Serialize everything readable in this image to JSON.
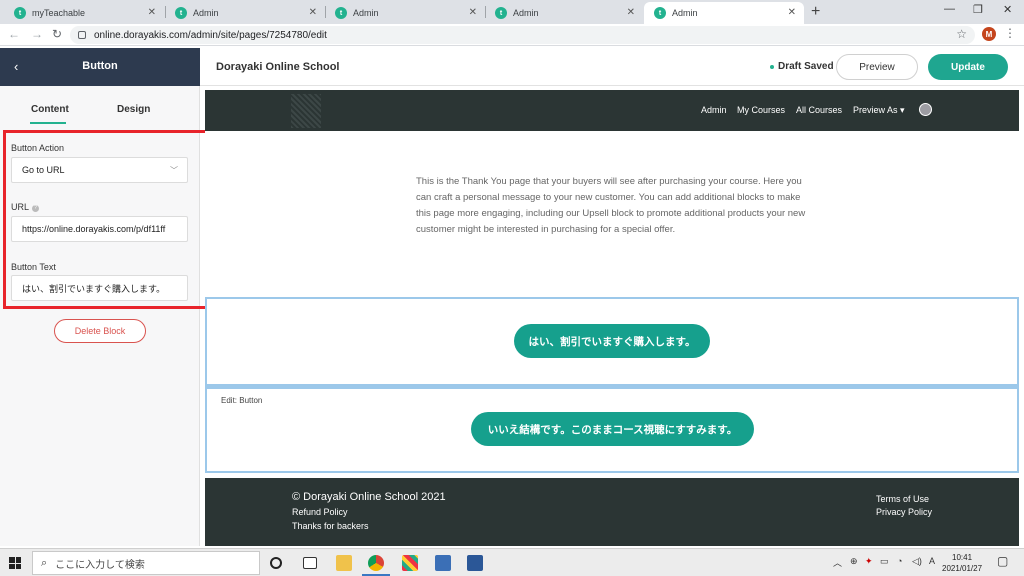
{
  "browser": {
    "tabs": [
      {
        "title": "myTeachable",
        "icon": "teachable-favicon"
      },
      {
        "title": "Admin",
        "icon": "teachable-favicon"
      },
      {
        "title": "Admin",
        "icon": "teachable-favicon"
      },
      {
        "title": "Admin",
        "icon": "teachable-favicon"
      },
      {
        "title": "Admin",
        "icon": "teachable-favicon"
      }
    ],
    "active_tab": 4,
    "url": "online.dorayakis.com/admin/site/pages/7254780/edit",
    "profile_initial": "M"
  },
  "editor": {
    "panel_title": "Button",
    "school_name": "Dorayaki Online School",
    "draft_status": "Draft Saved",
    "preview_label": "Preview",
    "update_label": "Update",
    "tabs": [
      "Content",
      "Design"
    ],
    "active_tab": "Content",
    "button_action_label": "Button Action",
    "button_action_value": "Go to URL",
    "url_label": "URL",
    "url_value": "https://online.dorayakis.com/p/df11ff",
    "button_text_label": "Button Text",
    "button_text_value": "はい、割引でいますぐ購入します。",
    "delete_label": "Delete Block",
    "highlight_color": "#e8242b"
  },
  "site": {
    "nav": [
      "Admin",
      "My Courses",
      "All Courses",
      "Preview As ▾"
    ],
    "thank_you_text": "This is the Thank You page that your buyers will see after purchasing your course. Here you can craft a personal message to your new customer. You can add additional blocks to make this page more engaging, including our Upsell block to promote additional products your new customer might be interested in purchasing for a special offer.",
    "yes_button": "はい、割引でいますぐ購入します。",
    "edit_label": "Edit: Button",
    "no_button": "いいえ結構です。このままコース視聴にすすみます。",
    "footer": {
      "copyright": "© Dorayaki Online School 2021",
      "left_links": [
        "Refund Policy",
        "Thanks for backers"
      ],
      "right_links": [
        "Terms of Use",
        "Privacy Policy"
      ]
    },
    "accent_color": "#16a08d"
  },
  "taskbar": {
    "search_placeholder": "ここに入力して検索",
    "time": "10:41",
    "date": "2021/01/27"
  }
}
